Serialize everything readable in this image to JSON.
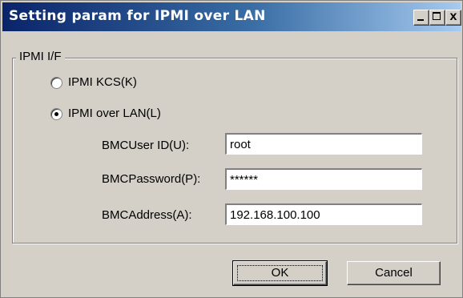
{
  "window": {
    "title": "Setting param for IPMI over LAN",
    "controls": {
      "minimize": "_",
      "maximize": "□",
      "close": "x"
    }
  },
  "group": {
    "label": "IPMI I/F",
    "options": [
      {
        "label": "IPMI KCS(K)",
        "selected": false
      },
      {
        "label": "IPMI over LAN(L)",
        "selected": true
      }
    ]
  },
  "fields": {
    "user_id": {
      "label": "BMCUser ID(U):",
      "value": "root"
    },
    "password": {
      "label": "BMCPassword(P):",
      "value": "******"
    },
    "address": {
      "label": "BMCAddress(A):",
      "value": "192.168.100.100"
    }
  },
  "buttons": {
    "ok": "OK",
    "cancel": "Cancel"
  }
}
